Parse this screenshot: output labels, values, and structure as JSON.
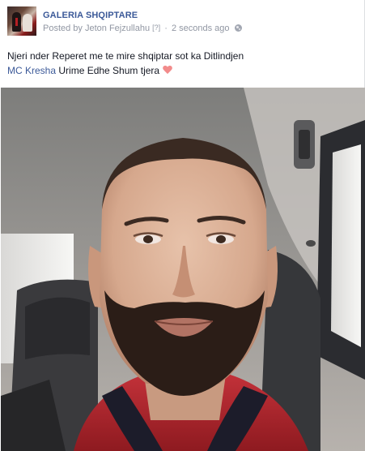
{
  "post": {
    "page_name": "GALERIA SHQIPTARE",
    "posted_by_prefix": "Posted by",
    "author": "Jeton Fejzullahu",
    "author_note": "[?]",
    "separator": "·",
    "timestamp": "2 seconds ago",
    "audience_icon": "globe-icon",
    "message": {
      "line1": "Njeri nder Reperet me te mire shqiptar sot ka Ditlindjen",
      "mention": "MC Kresha",
      "line2_rest": " Urime Edhe Shum tjera",
      "emoji": "heart-icon"
    },
    "photo": {
      "icon": "photo-image"
    }
  },
  "colors": {
    "link": "#3b5998",
    "meta": "#9197a3",
    "text": "#141823",
    "shirt": "#b3232a"
  }
}
